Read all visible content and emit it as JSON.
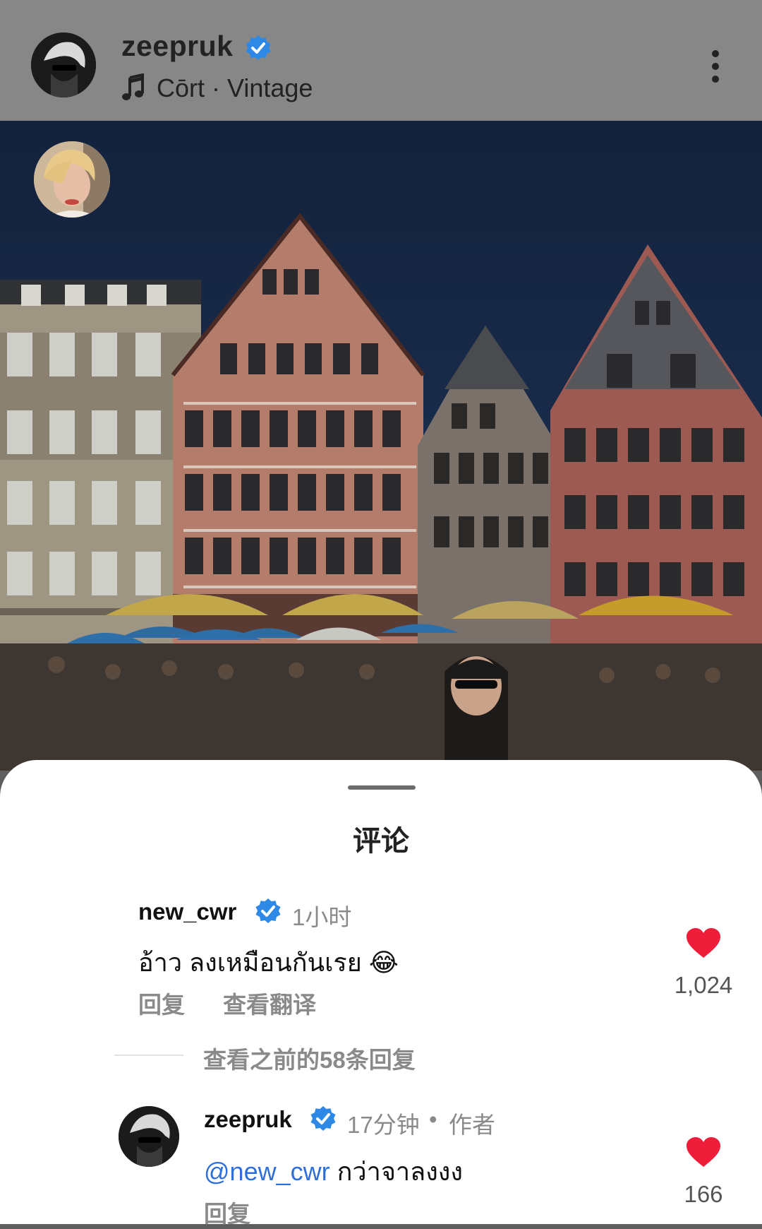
{
  "header": {
    "username": "zeepruk",
    "track": "Cōrt · Vintage"
  },
  "comments_sheet": {
    "title": "评论",
    "comment": {
      "username": "new_cwr",
      "time": "1小时",
      "text": "อ้าว ลงเหมือนกันเรย 😂",
      "reply_label": "回复",
      "translate_label": "查看翻译",
      "likes": "1,024"
    },
    "view_previous_label": "查看之前的58条回复",
    "reply": {
      "username": "zeepruk",
      "time": "17分钟",
      "separator": "•",
      "author_label": "作者",
      "mention": "@new_cwr",
      "text": " กว่าจาลงงง",
      "reply_label": "回复",
      "likes": "166"
    }
  },
  "colors": {
    "verified": "#2d88e6",
    "heart": "#ee1d3a",
    "mention": "#2f6fd8",
    "secondary_text": "#8a8a8a"
  }
}
